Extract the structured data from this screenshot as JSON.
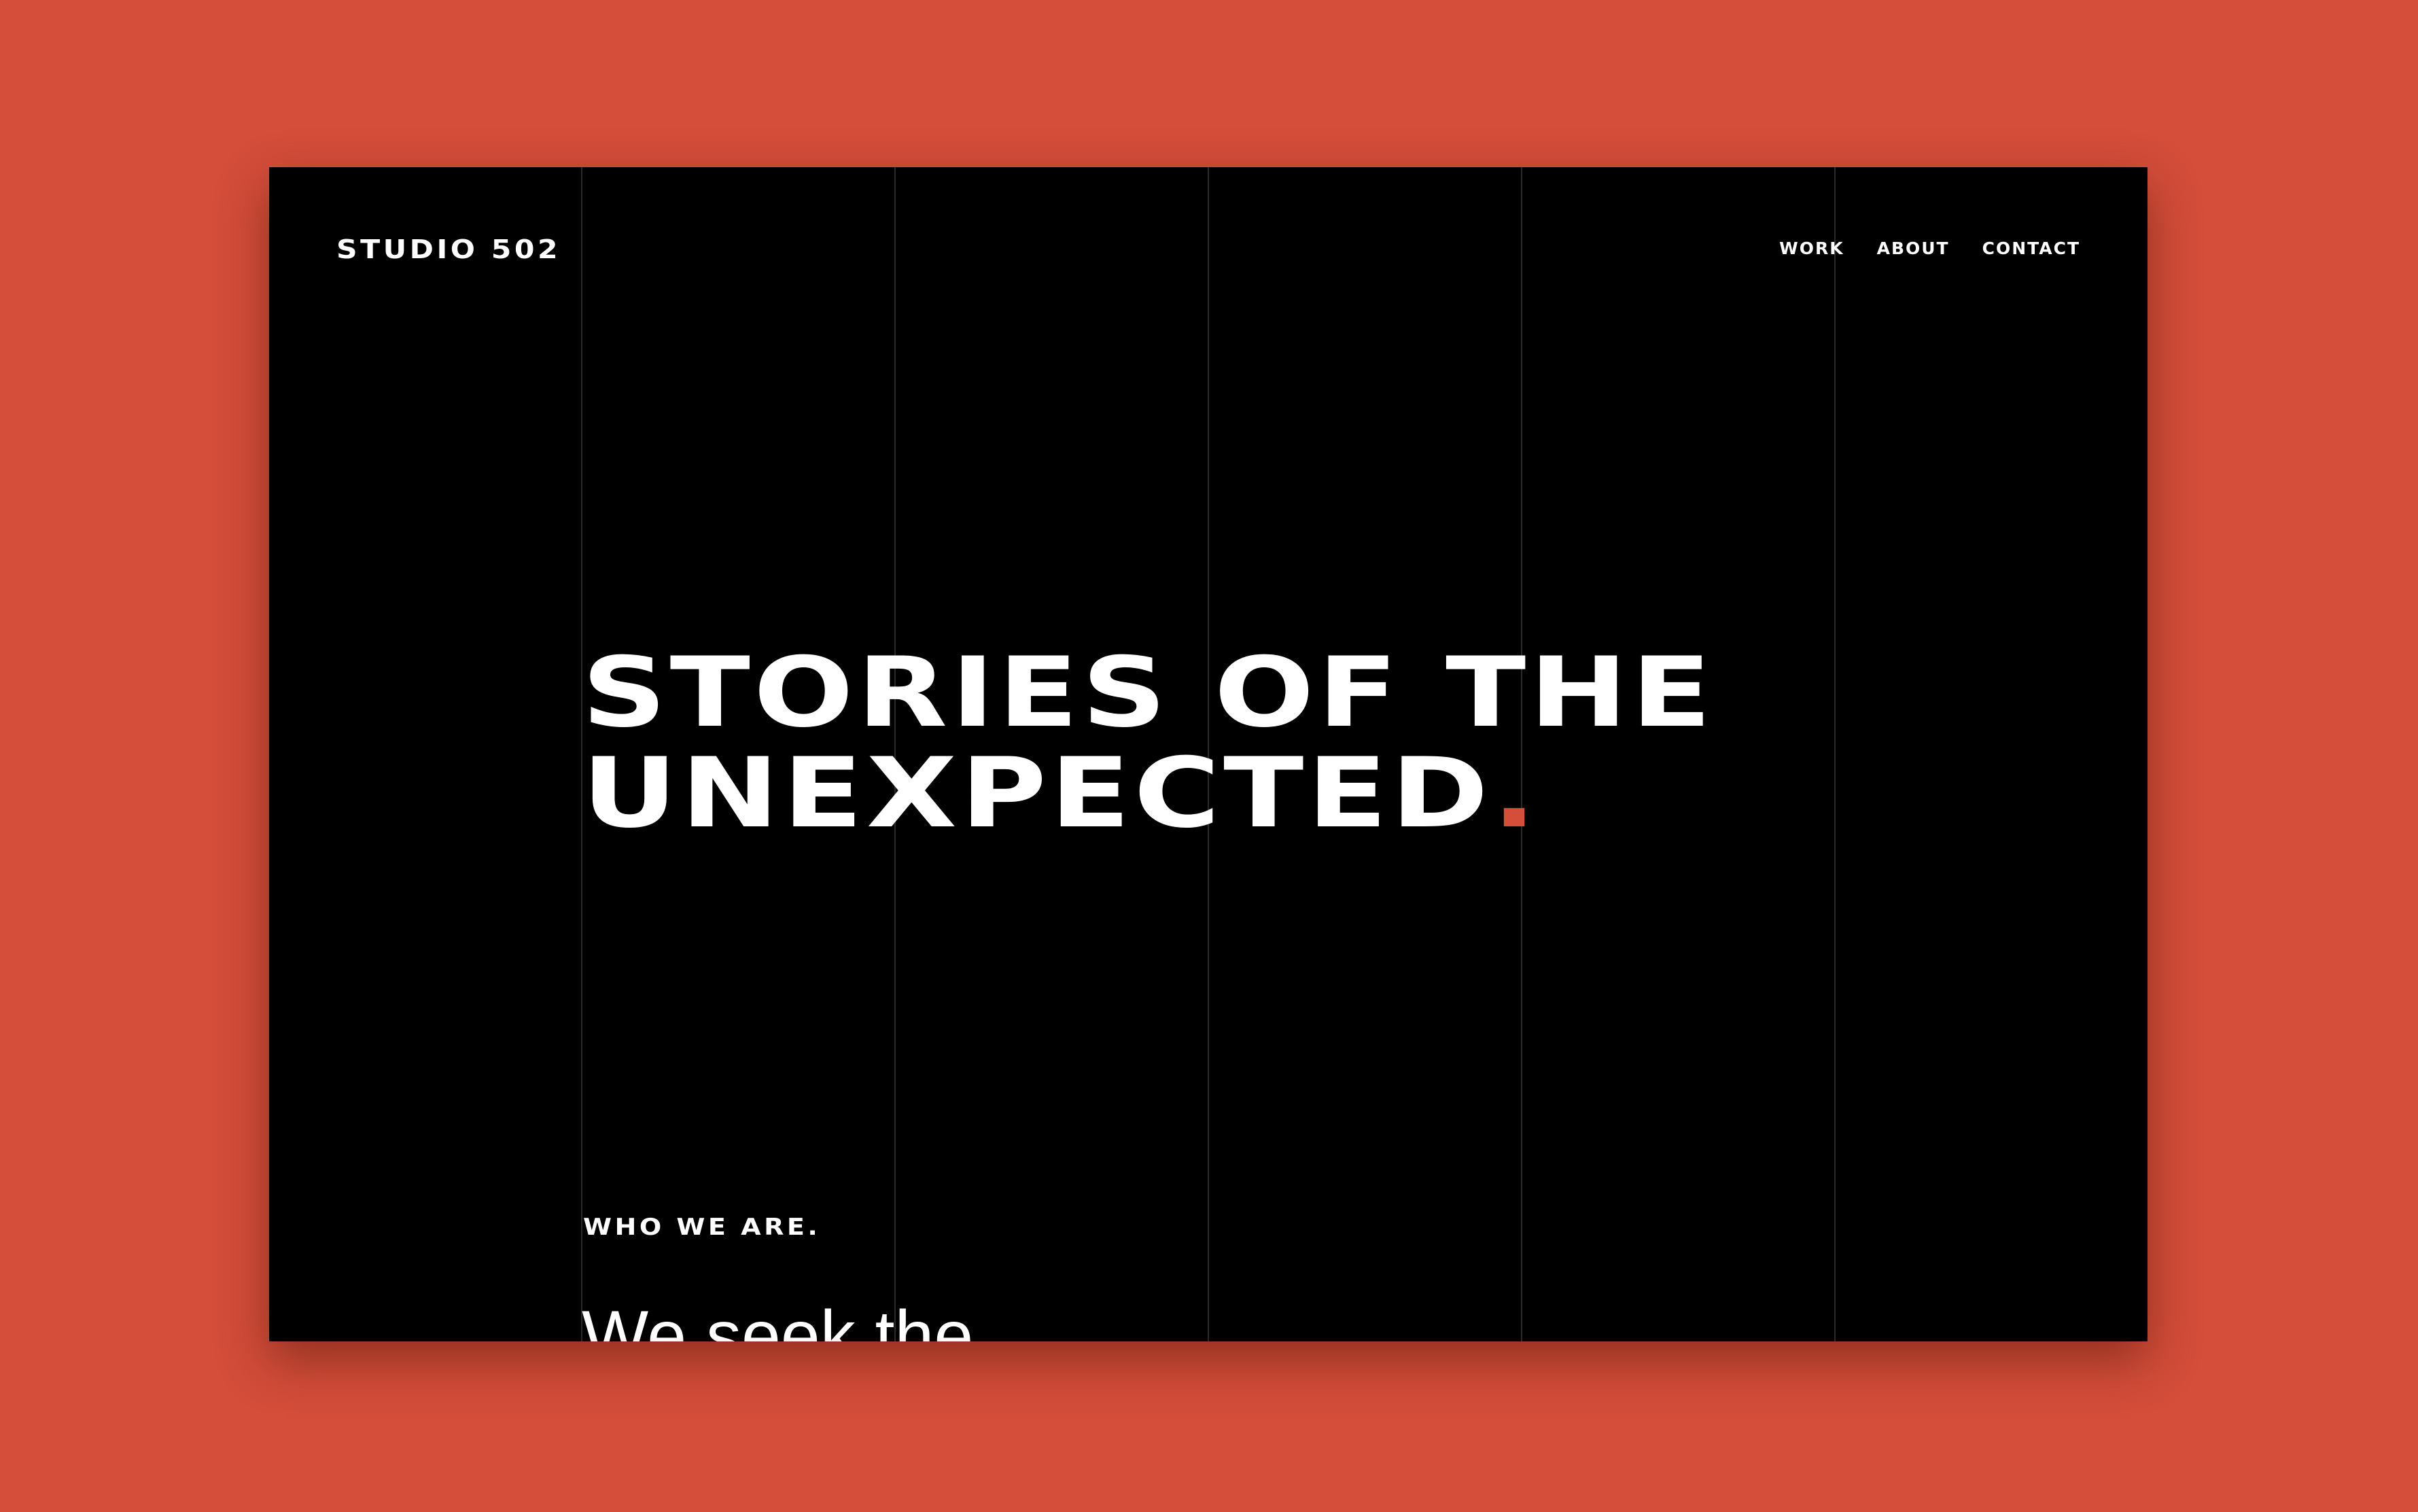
{
  "header": {
    "logo": "STUDIO 502",
    "nav": [
      {
        "label": "WORK"
      },
      {
        "label": "ABOUT"
      },
      {
        "label": "CONTACT"
      }
    ]
  },
  "hero": {
    "headline_line1": "STORIES OF THE",
    "headline_line2": "UNEXPECTED",
    "headline_dot": "."
  },
  "about": {
    "label": "WHO WE ARE.",
    "intro": "We seek the"
  },
  "colors": {
    "background": "#d44e3a",
    "page": "#000000",
    "text": "#ffffff",
    "accent": "#d44e3a",
    "grid_line": "#2a2a2a"
  }
}
